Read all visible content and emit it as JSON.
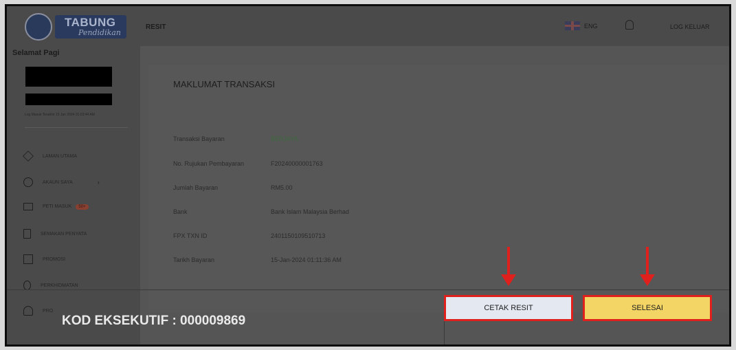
{
  "header": {
    "logo_main": "TABUNG",
    "logo_sub": "Pendidikan",
    "page_title": "RESIT",
    "language": "ENG",
    "logout": "LOG KELUAR"
  },
  "sidebar": {
    "greeting": "Selamat Pagi",
    "last_login": "Log Masuk Terakhir 15 Jan 2024 01:03:44 AM",
    "items": [
      {
        "label": "LAMAN UTAMA"
      },
      {
        "label": "AKAUN SAYA"
      },
      {
        "label": "PETI MASUK",
        "badge": "50+"
      },
      {
        "label": "SEMAKAN PENYATA"
      },
      {
        "label": "PROMOSI"
      },
      {
        "label": "PERKHIDMATAN"
      },
      {
        "label": "PRO"
      }
    ]
  },
  "transaction": {
    "title": "MAKLUMAT TRANSAKSI",
    "rows": [
      {
        "label": "Transaksi Bayaran",
        "value": "BERJAYA"
      },
      {
        "label": "No. Rujukan Pembayaran",
        "value": "F20240000001763"
      },
      {
        "label": "Jumlah Bayaran",
        "value": "RM5.00"
      },
      {
        "label": "Bank",
        "value": "Bank Islam Malaysia Berhad"
      },
      {
        "label": "FPX TXN ID",
        "value": "2401150109510713"
      },
      {
        "label": "Tarikh Bayaran",
        "value": "15-Jan-2024 01:11:36 AM"
      }
    ]
  },
  "actions": {
    "print_label": "CETAK RESIT",
    "done_label": "SELESAI"
  },
  "overlay": {
    "kod_eksekutif": "KOD EKSEKUTIF : 000009869"
  },
  "colors": {
    "highlight_border": "#e0201c",
    "print_button_bg": "#e4e8f1",
    "done_button_bg": "#f3d565"
  }
}
